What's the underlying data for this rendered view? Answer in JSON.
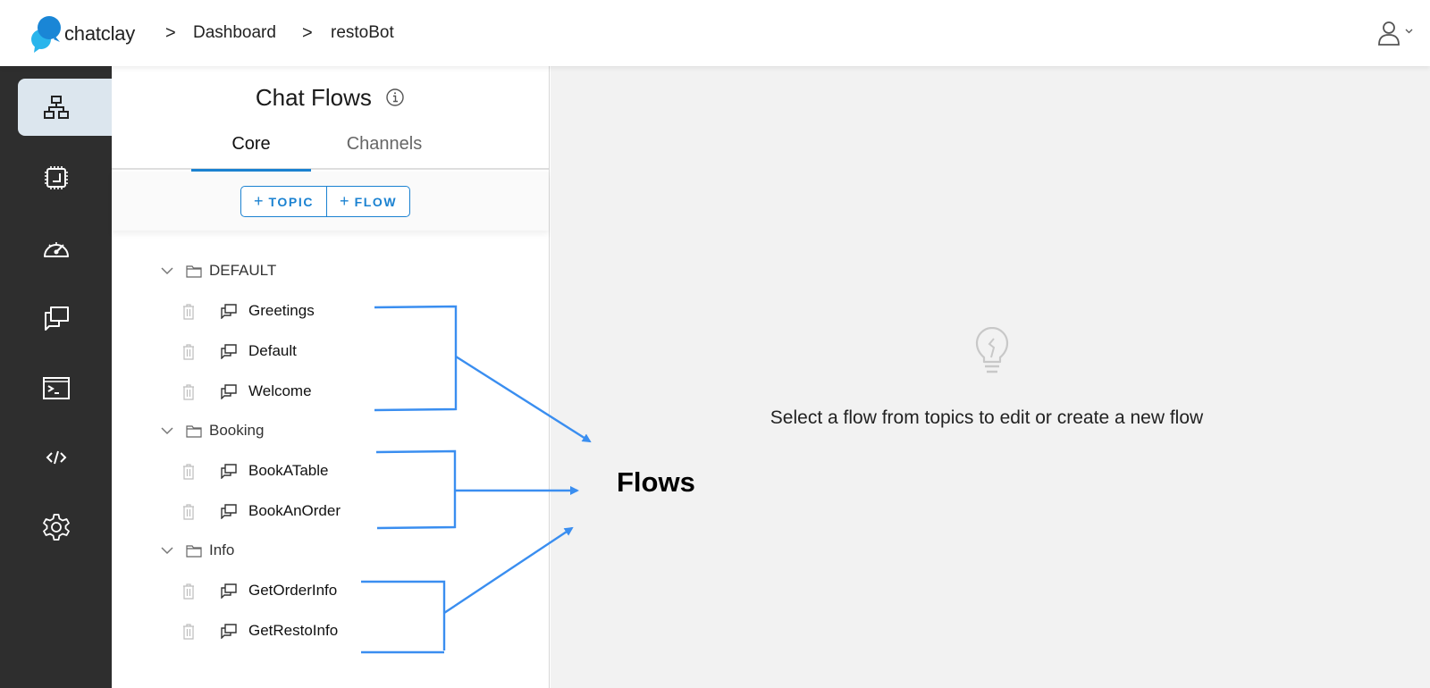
{
  "header": {
    "brand": "chatclay",
    "breadcrumb": [
      {
        "label": "Dashboard"
      },
      {
        "label": "restoBot"
      }
    ],
    "separator": ">",
    "user_icon": "user-icon",
    "colors": {
      "logo_dark": "#1a86d6",
      "logo_light": "#29b5ec"
    }
  },
  "rail": {
    "items": [
      {
        "icon": "sitemap-icon",
        "active": true
      },
      {
        "icon": "chip-icon",
        "active": false
      },
      {
        "icon": "speedometer-icon",
        "active": false
      },
      {
        "icon": "chat-bubbles-icon",
        "active": false
      },
      {
        "icon": "terminal-icon",
        "active": false
      },
      {
        "icon": "code-icon",
        "active": false
      },
      {
        "icon": "gear-icon",
        "active": false
      }
    ]
  },
  "panel": {
    "title": "Chat Flows",
    "tabs": [
      {
        "label": "Core",
        "active": true
      },
      {
        "label": "Channels",
        "active": false
      }
    ],
    "buttons": {
      "topic": "TOPIC",
      "flow": "FLOW",
      "plus": "+"
    },
    "topics": [
      {
        "name": "DEFAULT",
        "expanded": true,
        "flows": [
          "Greetings",
          "Default",
          "Welcome"
        ]
      },
      {
        "name": "Booking",
        "expanded": true,
        "flows": [
          "BookATable",
          "BookAnOrder"
        ]
      },
      {
        "name": "Info",
        "expanded": true,
        "flows": [
          "GetOrderInfo",
          "GetRestoInfo"
        ]
      }
    ],
    "accent": "#1b82d1"
  },
  "main": {
    "empty_message": "Select a flow from topics to edit or create a new flow",
    "empty_icon": "lightbulb-icon"
  },
  "annotation": {
    "label": "Flows",
    "color": "#3a8ef0"
  }
}
